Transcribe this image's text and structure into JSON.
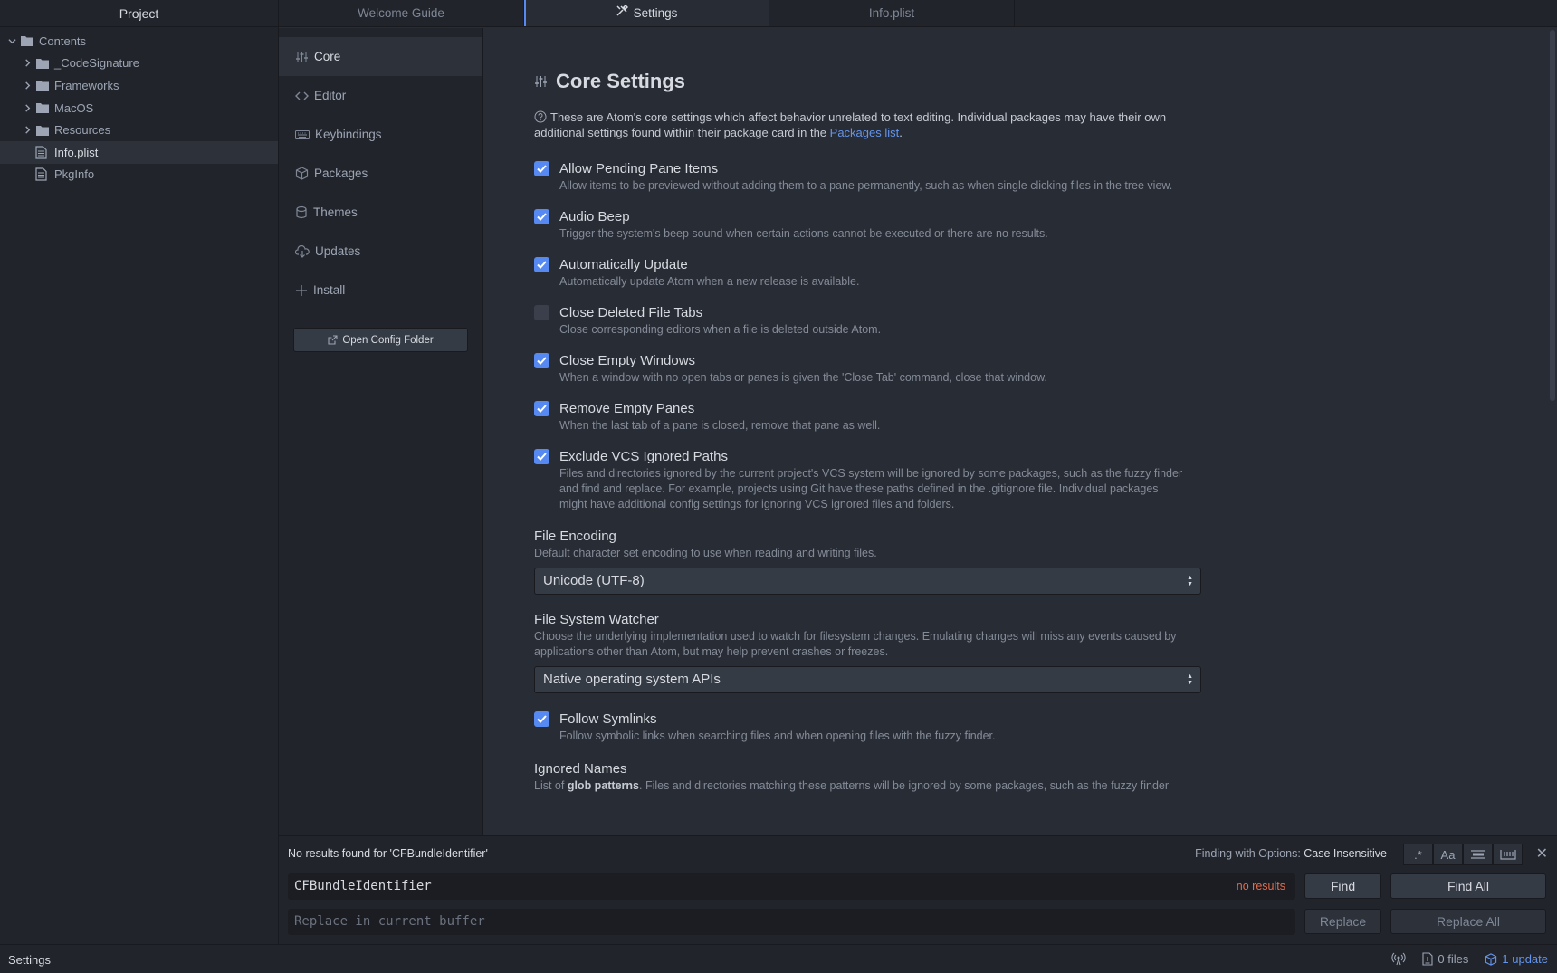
{
  "tree": {
    "header": "Project",
    "root": "Contents",
    "items": [
      {
        "label": "_CodeSignature",
        "type": "folder"
      },
      {
        "label": "Frameworks",
        "type": "folder"
      },
      {
        "label": "MacOS",
        "type": "folder"
      },
      {
        "label": "Resources",
        "type": "folder"
      },
      {
        "label": "Info.plist",
        "type": "file"
      },
      {
        "label": "PkgInfo",
        "type": "file"
      }
    ]
  },
  "tabs": [
    "Welcome Guide",
    "Settings",
    "Info.plist"
  ],
  "nav": {
    "items": [
      "Core",
      "Editor",
      "Keybindings",
      "Packages",
      "Themes",
      "Updates",
      "Install"
    ],
    "open_config": "Open Config Folder"
  },
  "panel": {
    "title": "Core Settings",
    "intro": "These are Atom's core settings which affect behavior unrelated to text editing. Individual packages may have their own additional settings found within their package card in the ",
    "intro_link": "Packages list",
    "intro_end": ".",
    "settings": [
      {
        "title": "Allow Pending Pane Items",
        "desc": "Allow items to be previewed without adding them to a pane permanently, such as when single clicking files in the tree view.",
        "checked": true
      },
      {
        "title": "Audio Beep",
        "desc": "Trigger the system's beep sound when certain actions cannot be executed or there are no results.",
        "checked": true
      },
      {
        "title": "Automatically Update",
        "desc": "Automatically update Atom when a new release is available.",
        "checked": true
      },
      {
        "title": "Close Deleted File Tabs",
        "desc": "Close corresponding editors when a file is deleted outside Atom.",
        "checked": false
      },
      {
        "title": "Close Empty Windows",
        "desc": "When a window with no open tabs or panes is given the 'Close Tab' command, close that window.",
        "checked": true
      },
      {
        "title": "Remove Empty Panes",
        "desc": "When the last tab of a pane is closed, remove that pane as well.",
        "checked": true
      },
      {
        "title": "Exclude VCS Ignored Paths",
        "desc": "Files and directories ignored by the current project's VCS system will be ignored by some packages, such as the fuzzy finder and find and replace. For example, projects using Git have these paths defined in the .gitignore file. Individual packages might have additional config settings for ignoring VCS ignored files and folders.",
        "checked": true
      }
    ],
    "file_encoding": {
      "title": "File Encoding",
      "desc": "Default character set encoding to use when reading and writing files.",
      "value": "Unicode (UTF-8)"
    },
    "file_watcher": {
      "title": "File System Watcher",
      "desc": "Choose the underlying implementation used to watch for filesystem changes. Emulating changes will miss any events caused by applications other than Atom, but may help prevent crashes or freezes.",
      "value": "Native operating system APIs"
    },
    "follow_symlinks": {
      "title": "Follow Symlinks",
      "desc": "Follow symbolic links when searching files and when opening files with the fuzzy finder.",
      "checked": true
    },
    "ignored_names": {
      "title": "Ignored Names",
      "desc_prefix": "List of ",
      "desc_bold": "glob patterns",
      "desc_rest": ". Files and directories matching these patterns will be ignored by some packages, such as the fuzzy finder"
    }
  },
  "find": {
    "message": "No results found for 'CFBundleIdentifier'",
    "options_label": "Finding with Options:",
    "options_value": "Case Insensitive",
    "query": "CFBundleIdentifier",
    "no_results": "no results",
    "replace_placeholder": "Replace in current buffer",
    "find_label": "Find",
    "find_all_label": "Find All",
    "replace_label": "Replace",
    "replace_all_label": "Replace All",
    "opt_regex": ".*",
    "opt_case": "Aa"
  },
  "status": {
    "left": "Settings",
    "files": "0 files",
    "update": "1 update"
  },
  "colors": {
    "accent": "#568af2",
    "link": "#6494ed",
    "error": "#e06c4e"
  }
}
